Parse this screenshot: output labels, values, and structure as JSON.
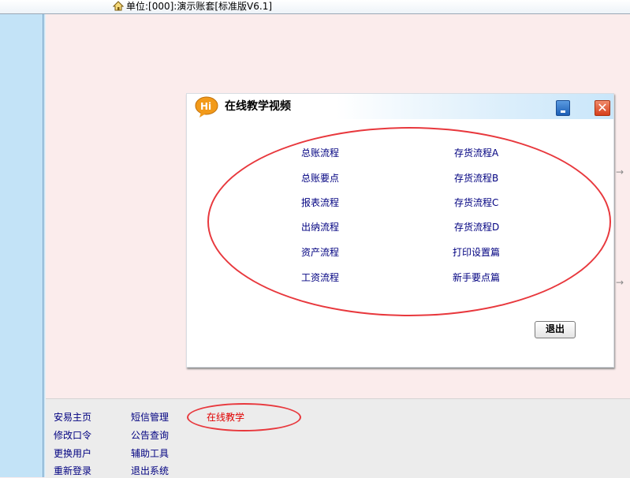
{
  "header": {
    "unit_label": "单位:[000]:演示账套[标准版V6.1]",
    "home_icon": "home-icon"
  },
  "dialog": {
    "title": "在线教学视频",
    "logo_text": "Hi",
    "close_glyph": "✕",
    "links_left": [
      "总账流程",
      "总账要点",
      "报表流程",
      "出纳流程",
      "资产流程",
      "工资流程"
    ],
    "links_right": [
      "存货流程A",
      "存货流程B",
      "存货流程C",
      "存货流程D",
      "打印设置篇",
      "新手要点篇"
    ],
    "exit_label": "退出",
    "annotation_color": "#e8383d"
  },
  "bottom_menu": {
    "col1": [
      "安易主页",
      "修改口令",
      "更换用户",
      "重新登录"
    ],
    "col2": [
      "短信管理",
      "公告查询",
      "辅助工具",
      "退出系统"
    ],
    "active": "在线教学",
    "active_color": "#e00000"
  }
}
